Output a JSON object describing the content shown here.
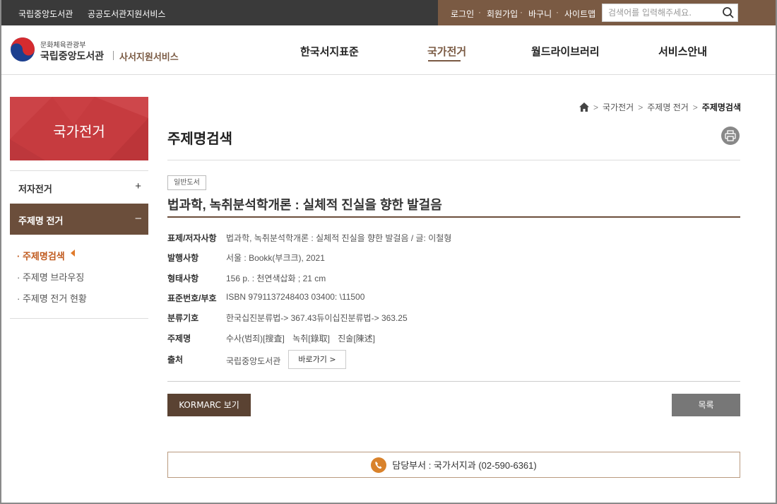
{
  "topbar": {
    "site_links": [
      "국립중앙도서관",
      "공공도서관지원서비스"
    ],
    "util_links": [
      "로그인",
      "회원가입",
      "바구니",
      "사이트맵"
    ],
    "separator": "·",
    "search_placeholder": "검색어를 입력해주세요."
  },
  "header": {
    "logo_small": "문화체육관광부",
    "logo_big": "국립중앙도서관",
    "logo_sub": "사서지원서비스",
    "nav": [
      "한국서지표준",
      "국가전거",
      "월드라이브러리",
      "서비스안내"
    ],
    "active_nav": "국가전거"
  },
  "sidebar": {
    "banner_title": "국가전거",
    "menus": [
      {
        "label": "저자전거",
        "sign": "+"
      },
      {
        "label": "주제명 전거",
        "sign": "–"
      }
    ],
    "sub_items": [
      "· 주제명검색",
      "· 주제명 브라우징",
      "· 주제명 전거 현황"
    ]
  },
  "breadcrumb": [
    "국가전거",
    "주제명 전거",
    "주제명검색"
  ],
  "page_title": "주제명검색",
  "record": {
    "badge": "일반도서",
    "title": "법과학, 녹취분석학개론 : 실체적 진실을 향한 발걸음",
    "fields": [
      {
        "label": "표제/저자사항",
        "value": "법과학, 녹취분석학개론 : 실체적 진실을 향한 발걸음 / 글: 이철형"
      },
      {
        "label": "발행사항",
        "value": "서울 : Bookk(부크크), 2021"
      },
      {
        "label": "형태사항",
        "value": "156 p. : 천연색삽화 ; 21 cm"
      },
      {
        "label": "표준번호/부호",
        "value": "ISBN 9791137248403 03400: \\11500"
      },
      {
        "label": "분류기호",
        "value": "한국십진분류법-> 367.43듀이십진분류법-> 363.25"
      },
      {
        "label": "주제명",
        "value": ""
      },
      {
        "label": "출처",
        "value": "국립중앙도서관"
      }
    ],
    "subjects": [
      "수사(범죄)[搜査]",
      "녹취[錄取]",
      "진술[陳述]"
    ],
    "goto_label": "바로가기 >"
  },
  "buttons": {
    "kormarc": "KORMARC 보기",
    "list": "목록"
  },
  "contact": {
    "text": "담당부서 : 국가서지과 (02-590-6361)"
  },
  "colors": {
    "brown": "#7a5a43",
    "dark_brown": "#5a4232",
    "red": "#c63b3f",
    "topbar": "#3a3a3a"
  }
}
